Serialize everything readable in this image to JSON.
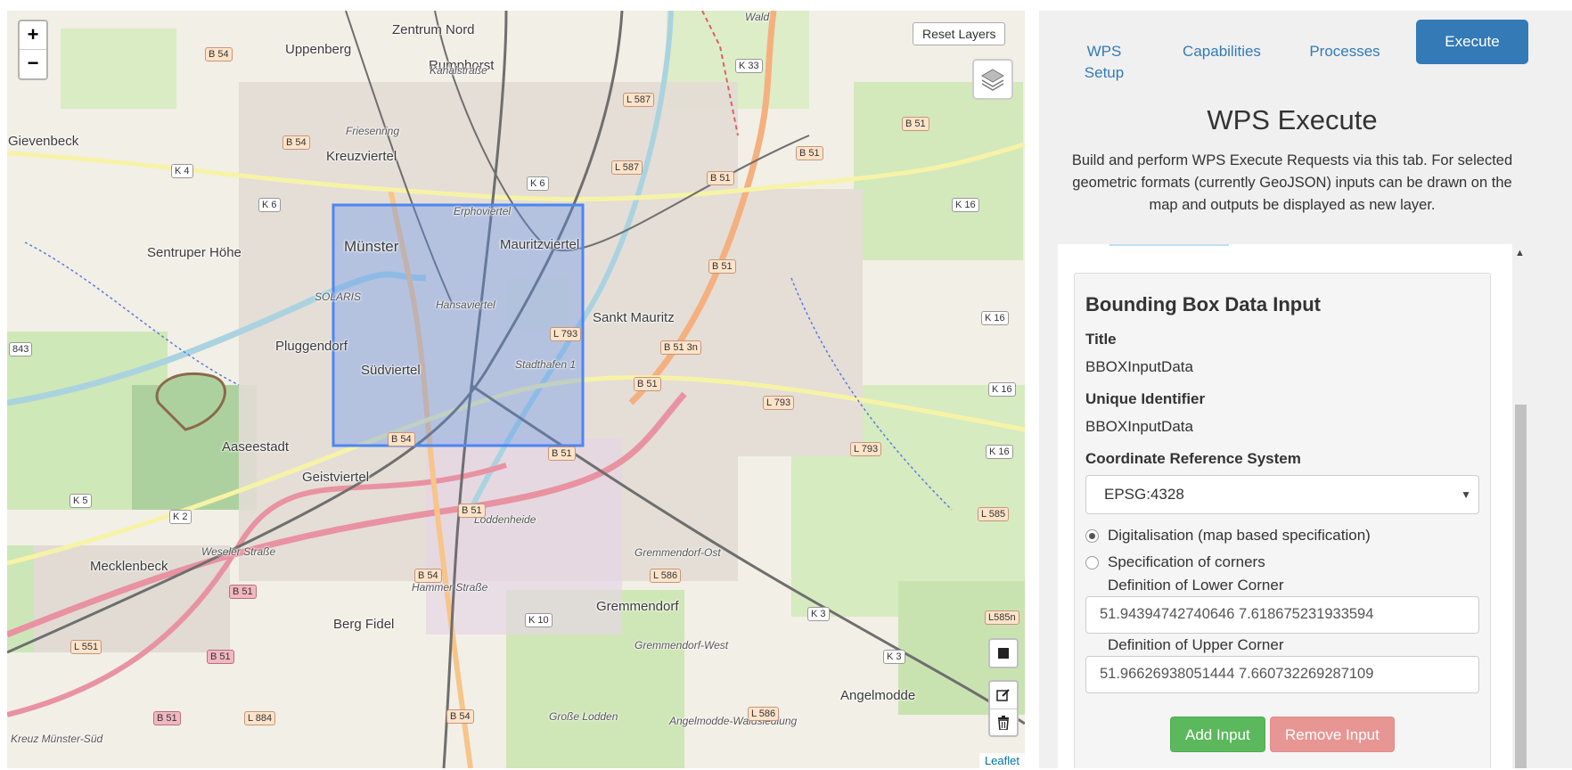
{
  "map": {
    "zoom_in": "+",
    "zoom_out": "−",
    "reset_layers": "Reset Layers",
    "attribution": "Leaflet",
    "places": {
      "zentrum_nord": "Zentrum Nord",
      "uppenberg": "Uppenberg",
      "rumphorst": "Rumphorst",
      "gievenbeck": "Gievenbeck",
      "kreuzviertel": "Kreuzviertel",
      "sentruper_hoehe": "Sentruper Höhe",
      "muenster": "Münster",
      "mauritzviertel": "Mauritzviertel",
      "erphoviertel": "Erphoviertel",
      "hansaviertel": "Hansaviertel",
      "sankt_mauritz": "Sankt Mauritz",
      "pluggendorf": "Pluggendorf",
      "suedviertel": "Südviertel",
      "aaseestadt": "Aaseestadt",
      "geistviertel": "Geistviertel",
      "loddenheide": "Loddenheide",
      "mecklenbeck": "Mecklenbeck",
      "berg_fidel": "Berg Fidel",
      "gremmendorf": "Gremmendorf",
      "gremmendorf_ost": "Gremmendorf-Ost",
      "gremmendorf_west": "Gremmendorf-West",
      "angelmodde": "Angelmodde",
      "grosse_lodden": "Große Lodden",
      "angelmodde_waldsiedlung": "Angelmodde-Waldsiedlung",
      "kreuz": "Kreuz Münster-Süd",
      "wald": "Wald",
      "friesenring": "Friesenring",
      "stadthafen": "Stadthafen 1",
      "hammer_strasse": "Hammer Straße",
      "weseler_strasse": "Weseler Straße",
      "kanalstrasse": "Kanalstraße",
      "solaris": "SOLARIS"
    },
    "shields": {
      "b54_top": "B 54",
      "b54_a": "B 54",
      "b54_b": "B 54",
      "b54_c": "B 54",
      "b54_d": "B 54",
      "k33": "K 33",
      "l587a": "L 587",
      "l587b": "L 587",
      "b51a": "B 51",
      "b51b": "B 51",
      "b51c": "B 51",
      "b51d": "B 51",
      "b51e": "B 51",
      "b51f": "B 51",
      "b51g": "B 51",
      "b51h": "B 51",
      "b51i": "B 51",
      "b51j": "B 51",
      "k4": "K 4",
      "k6a": "K 6",
      "k6b": "K 6",
      "k16a": "K 16",
      "k16b": "K 16",
      "k16c": "K 16",
      "k16d": "K 16",
      "l793a": "L 793",
      "l793b": "L 793",
      "l793c": "L 793",
      "n843": "843",
      "k5": "K 5",
      "k2": "K 2",
      "l586a": "L 586",
      "l586b": "L 586",
      "k10": "K 10",
      "k3a": "K 3",
      "k3b": "K 3",
      "l551": "L 551",
      "l884": "L 884",
      "l585": "L 585",
      "l585n": "L585n",
      "b513n": "B 51 3n"
    }
  },
  "panel": {
    "tabs": {
      "setup": "WPS Setup",
      "capabilities": "Capabilities",
      "processes": "Processes",
      "execute": "Execute"
    },
    "heading": "WPS Execute",
    "description": "Build and perform WPS Execute Requests via this tab. For selected geometric formats (currently GeoJSON) inputs can be drawn on the map and outputs be displayed as new layer.",
    "card": {
      "title": "Bounding Box Data Input",
      "title_label": "Title",
      "title_value": "BBOXInputData",
      "identifier_label": "Unique Identifier",
      "identifier_value": "BBOXInputData",
      "crs_label": "Coordinate Reference System",
      "crs_value": "EPSG:4328",
      "radio_digitalisation": "Digitalisation (map based specification)",
      "radio_corners": "Specification of corners",
      "lower_label": "Definition of Lower Corner",
      "lower_value": "51.94394742740646 7.618675231933594",
      "upper_label": "Definition of Upper Corner",
      "upper_value": "51.96626938051444 7.660732269287109",
      "add_button": "Add Input",
      "remove_button": "Remove Input"
    }
  },
  "colors": {
    "primary": "#337ab7",
    "success": "#5cb85c",
    "danger_muted": "#e89693",
    "bbox_fill": "#5b8ff0"
  }
}
